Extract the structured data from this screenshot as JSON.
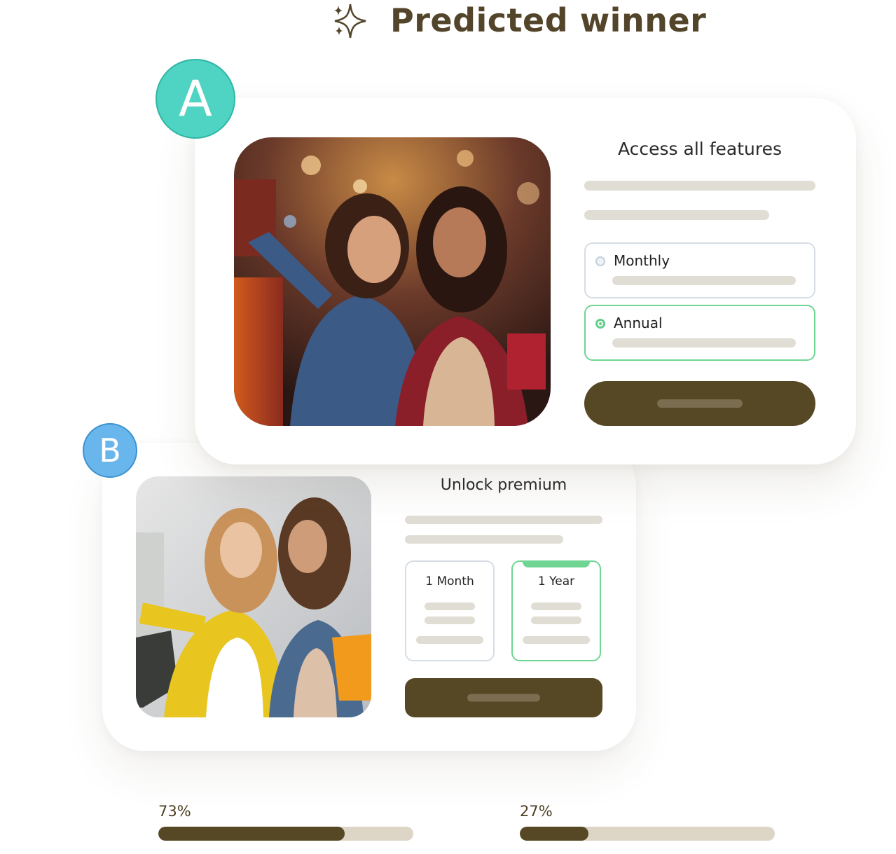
{
  "header": {
    "title": "Predicted winner",
    "icon": "sparkle-icon"
  },
  "variant_a": {
    "badge": "A",
    "headline": "Access all features",
    "plans": [
      {
        "label": "Monthly",
        "selected": false
      },
      {
        "label": "Annual",
        "selected": true
      }
    ]
  },
  "variant_b": {
    "badge": "B",
    "headline": "Unlock premium",
    "plans": [
      {
        "label": "1 Month",
        "selected": false
      },
      {
        "label": "1 Year",
        "selected": true
      }
    ]
  },
  "results": [
    {
      "label": "73%",
      "value": 0.73
    },
    {
      "label": "27%",
      "value": 0.27
    }
  ],
  "colors": {
    "brand_dark": "#574825",
    "badge_a": "#4fd3c2",
    "badge_b": "#68b6ec",
    "selected_green": "#6fd593",
    "skeleton": "#e0ddd4"
  }
}
